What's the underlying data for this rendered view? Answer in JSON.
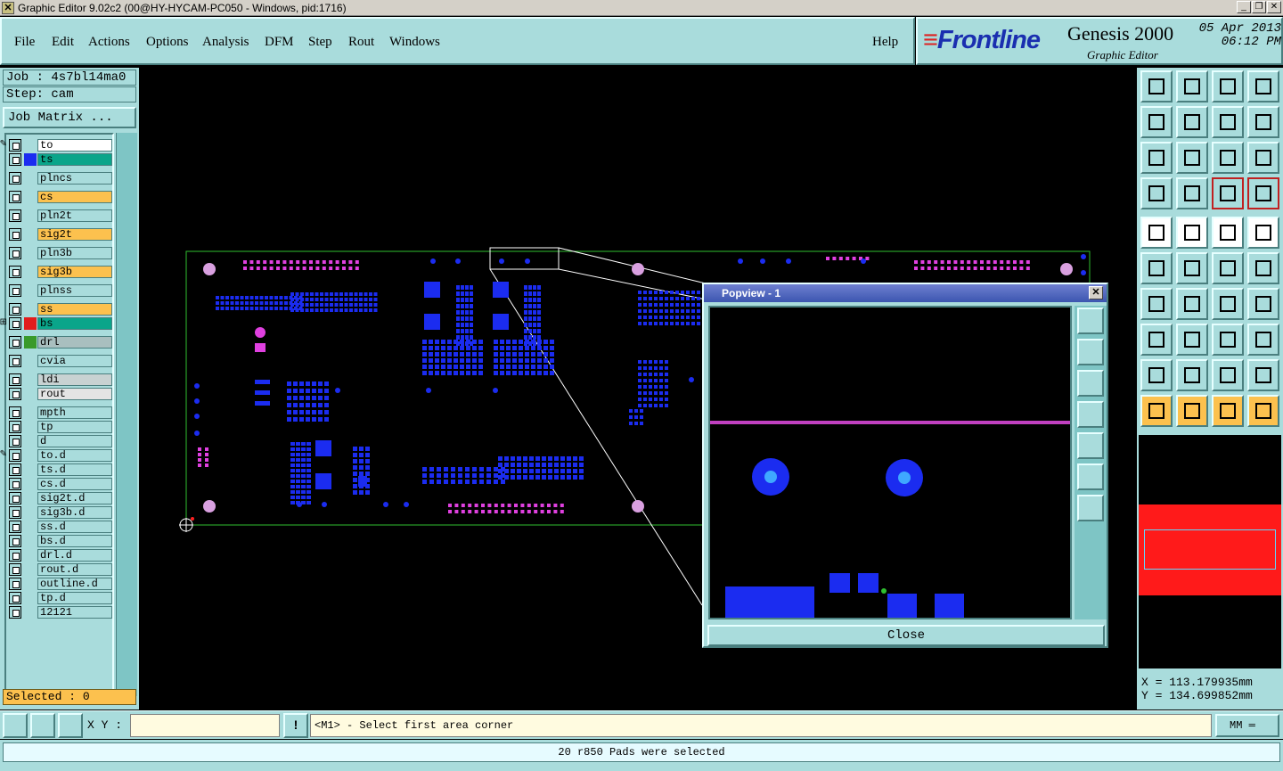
{
  "window": {
    "title": "Graphic Editor 9.02c2 (00@HY-HYCAM-PC050 - Windows, pid:1716)",
    "controls": [
      "minimize-icon",
      "maximize-icon",
      "close-icon"
    ]
  },
  "menu": {
    "items": [
      "File",
      "Edit",
      "Actions",
      "Options",
      "Analysis",
      "DFM",
      "Step",
      "Rout",
      "Windows"
    ],
    "help": "Help"
  },
  "brand": {
    "logo": "Frontline",
    "product": "Genesis 2000",
    "subtitle": "Graphic Editor",
    "date": "05 Apr 2013",
    "time": "06:12 PM"
  },
  "job": {
    "job_label": "Job : 4s7bl14ma0",
    "step_label": "Step: cam",
    "matrix_button": "Job Matrix ..."
  },
  "layers": [
    {
      "name": "to",
      "color": "#ffffff",
      "swatch": "",
      "marker": "✎"
    },
    {
      "name": "ts",
      "color": "#0aa58a",
      "swatch": "#1b2cf0",
      "marker": ""
    },
    {
      "name": "plncs",
      "color": "#a9dcdc",
      "swatch": "",
      "marker": ""
    },
    {
      "name": "cs",
      "color": "#fcc14e",
      "swatch": "",
      "marker": ""
    },
    {
      "name": "pln2t",
      "color": "#a9dcdc",
      "swatch": "",
      "marker": ""
    },
    {
      "name": "sig2t",
      "color": "#fcc14e",
      "swatch": "",
      "marker": ""
    },
    {
      "name": "pln3b",
      "color": "#a9dcdc",
      "swatch": "",
      "marker": ""
    },
    {
      "name": "sig3b",
      "color": "#fcc14e",
      "swatch": "",
      "marker": ""
    },
    {
      "name": "plnss",
      "color": "#a9dcdc",
      "swatch": "",
      "marker": ""
    },
    {
      "name": "ss",
      "color": "#fcc14e",
      "swatch": "",
      "marker": ""
    },
    {
      "name": "bs",
      "color": "#0aa58a",
      "swatch": "#e21d1d",
      "marker": "⊞"
    },
    {
      "name": "drl",
      "color": "#a9bfbf",
      "swatch": "#3a9a2a",
      "marker": ""
    },
    {
      "name": "cvia",
      "color": "#a9dcdc",
      "swatch": "",
      "marker": ""
    },
    {
      "name": "ldi",
      "color": "#c8d2d2",
      "swatch": "",
      "marker": ""
    },
    {
      "name": "rout",
      "color": "#e4e4e4",
      "swatch": "",
      "marker": ""
    },
    {
      "name": "mpth",
      "color": "#a9dcdc",
      "swatch": "",
      "marker": ""
    },
    {
      "name": "tp",
      "color": "#a9dcdc",
      "swatch": "",
      "marker": ""
    },
    {
      "name": "d",
      "color": "#a9dcdc",
      "swatch": "",
      "marker": ""
    },
    {
      "name": "to.d",
      "color": "#a9dcdc",
      "swatch": "",
      "marker": "✎"
    },
    {
      "name": "ts.d",
      "color": "#a9dcdc",
      "swatch": "",
      "marker": ""
    },
    {
      "name": "cs.d",
      "color": "#a9dcdc",
      "swatch": "",
      "marker": ""
    },
    {
      "name": "sig2t.d",
      "color": "#a9dcdc",
      "swatch": "",
      "marker": ""
    },
    {
      "name": "sig3b.d",
      "color": "#a9dcdc",
      "swatch": "",
      "marker": ""
    },
    {
      "name": "ss.d",
      "color": "#a9dcdc",
      "swatch": "",
      "marker": ""
    },
    {
      "name": "bs.d",
      "color": "#a9dcdc",
      "swatch": "",
      "marker": ""
    },
    {
      "name": "drl.d",
      "color": "#a9dcdc",
      "swatch": "",
      "marker": ""
    },
    {
      "name": "rout.d",
      "color": "#a9dcdc",
      "swatch": "",
      "marker": ""
    },
    {
      "name": "outline.d",
      "color": "#a9dcdc",
      "swatch": "",
      "marker": ""
    },
    {
      "name": "tp.d",
      "color": "#a9dcdc",
      "swatch": "",
      "marker": ""
    },
    {
      "name": "12121",
      "color": "#a9dcdc",
      "swatch": "",
      "marker": ""
    }
  ],
  "selected": "Selected : 0",
  "popview": {
    "title": "Popview - 1",
    "close_label": "Close"
  },
  "coords": {
    "x": "X = 113.179935mm",
    "y": "Y = 134.699852mm"
  },
  "bottom": {
    "xy_label": "X Y :",
    "xy_value": "",
    "prompt": "<M1> - Select first area corner",
    "units": "MM"
  },
  "status": "20 r850 Pads were selected",
  "colors": {
    "panel": "#a9dcdc",
    "highlight_yellow": "#fcc14e",
    "pad_blue": "#1b2cf0",
    "pad_magenta": "#e040e0",
    "board_outline": "#2fbf2f"
  }
}
